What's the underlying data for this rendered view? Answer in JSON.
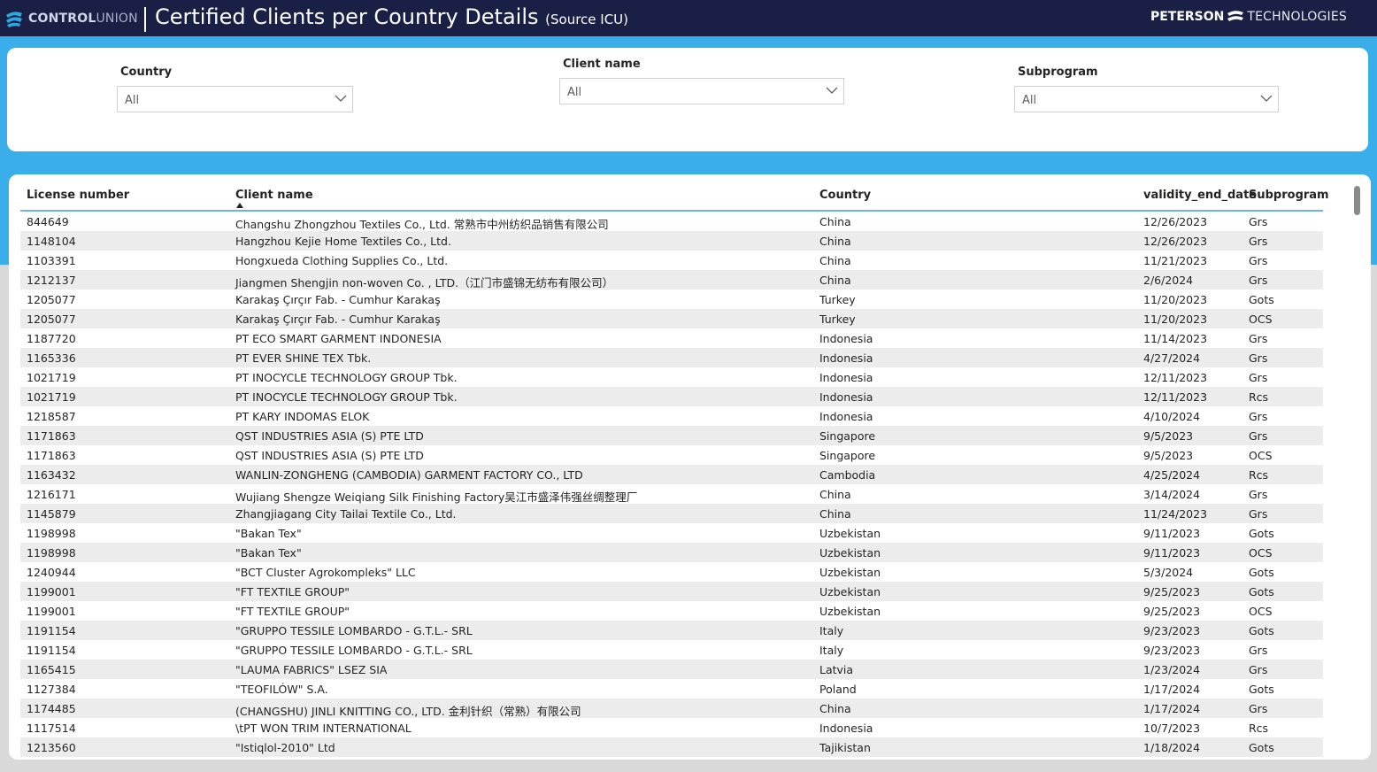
{
  "header": {
    "brand_left_bold": "CONTROL",
    "brand_left_light": "UNION",
    "title": "Certified Clients per Country Details",
    "title_source": "(Source ICU)",
    "brand_right_bold": "PETERSON",
    "brand_right_light": "TECHNOLOGIES"
  },
  "colors": {
    "header_bg": "#1a1f45",
    "accent_blue": "#3aaeea",
    "row_alt": "#ececec"
  },
  "filters": {
    "country": {
      "label": "Country",
      "value": "All"
    },
    "client_name": {
      "label": "Client name",
      "value": "All"
    },
    "subprogram": {
      "label": "Subprogram",
      "value": "All"
    }
  },
  "table": {
    "columns": [
      "License number",
      "Client name",
      "Country",
      "validity_end_date",
      "Subprogram"
    ],
    "sorted_column": "Client name",
    "sort_direction": "ascending",
    "rows": [
      [
        "844649",
        "Changshu Zhongzhou Textiles Co., Ltd. 常熟市中州纺织品销售有限公司",
        "China",
        "12/26/2023",
        "Grs"
      ],
      [
        "1148104",
        "Hangzhou Kejie Home Textiles Co., Ltd.",
        "China",
        "12/26/2023",
        "Grs"
      ],
      [
        "1103391",
        "Hongxueda Clothing Supplies Co., Ltd.",
        "China",
        "11/21/2023",
        "Grs"
      ],
      [
        "1212137",
        "Jiangmen Shengjin non-woven Co. , LTD.（江门市盛锦无纺布有限公司）",
        "China",
        "2/6/2024",
        "Grs"
      ],
      [
        "1205077",
        "Karakaş Çırçır Fab. - Cumhur Karakaş",
        "Turkey",
        "11/20/2023",
        "Gots"
      ],
      [
        "1205077",
        "Karakaş Çırçır Fab. - Cumhur Karakaş",
        "Turkey",
        "11/20/2023",
        "OCS"
      ],
      [
        "1187720",
        "PT ECO SMART GARMENT INDONESIA",
        "Indonesia",
        "11/14/2023",
        "Grs"
      ],
      [
        "1165336",
        "PT EVER SHINE TEX Tbk.",
        "Indonesia",
        "4/27/2024",
        "Grs"
      ],
      [
        "1021719",
        "PT INOCYCLE TECHNOLOGY GROUP Tbk.",
        "Indonesia",
        "12/11/2023",
        "Grs"
      ],
      [
        "1021719",
        "PT INOCYCLE TECHNOLOGY GROUP Tbk.",
        "Indonesia",
        "12/11/2023",
        "Rcs"
      ],
      [
        "1218587",
        "PT KARY INDOMAS ELOK",
        "Indonesia",
        "4/10/2024",
        "Grs"
      ],
      [
        "1171863",
        "QST INDUSTRIES ASIA (S) PTE LTD",
        "Singapore",
        "9/5/2023",
        "Grs"
      ],
      [
        "1171863",
        "QST INDUSTRIES ASIA (S) PTE LTD",
        "Singapore",
        "9/5/2023",
        "OCS"
      ],
      [
        "1163432",
        "WANLIN-ZONGHENG (CAMBODIA) GARMENT FACTORY CO., LTD",
        "Cambodia",
        "4/25/2024",
        "Rcs"
      ],
      [
        "1216171",
        "Wujiang Shengze Weiqiang Silk Finishing Factory吴江市盛泽伟强丝绸整理厂",
        "China",
        "3/14/2024",
        "Grs"
      ],
      [
        "1145879",
        "Zhangjiagang City Tailai Textile Co., Ltd.",
        "China",
        "11/24/2023",
        "Grs"
      ],
      [
        "1198998",
        "\"Bakan Tex\"",
        "Uzbekistan",
        "9/11/2023",
        "Gots"
      ],
      [
        "1198998",
        "\"Bakan Tex\"",
        "Uzbekistan",
        "9/11/2023",
        "OCS"
      ],
      [
        "1240944",
        "\"BCT Cluster Agrokompleks\" LLC",
        "Uzbekistan",
        "5/3/2024",
        "Gots"
      ],
      [
        "1199001",
        "\"FT TEXTILE GROUP\"",
        "Uzbekistan",
        "9/25/2023",
        "Gots"
      ],
      [
        "1199001",
        "\"FT TEXTILE GROUP\"",
        "Uzbekistan",
        "9/25/2023",
        "OCS"
      ],
      [
        "1191154",
        "\"GRUPPO TESSILE LOMBARDO - G.T.L.- SRL",
        "Italy",
        "9/23/2023",
        "Gots"
      ],
      [
        "1191154",
        "\"GRUPPO TESSILE LOMBARDO - G.T.L.- SRL",
        "Italy",
        "9/23/2023",
        "Grs"
      ],
      [
        "1165415",
        "\"LAUMA FABRICS\" LSEZ SIA",
        "Latvia",
        "1/23/2024",
        "Grs"
      ],
      [
        "1127384",
        "\"TEOFILÓW\" S.A.",
        "Poland",
        "1/17/2024",
        "Gots"
      ],
      [
        "1174485",
        "(CHANGSHU) JINLI KNITTING CO., LTD. 金利针织（常熟）有限公司",
        "China",
        "1/17/2024",
        "Grs"
      ],
      [
        "1117514",
        "\\tPT WON TRIM INTERNATIONAL",
        "Indonesia",
        "10/7/2023",
        "Rcs"
      ],
      [
        "1213560",
        "\"Istiqlol-2010\" Ltd",
        "Tajikistan",
        "1/18/2024",
        "Gots"
      ]
    ]
  }
}
